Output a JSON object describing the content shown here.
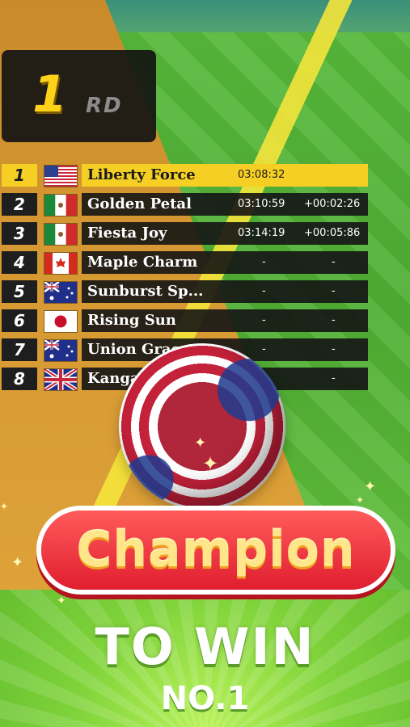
{
  "position": {
    "number": "1",
    "suffix": "RD"
  },
  "leaderboard": [
    {
      "pos": "1",
      "flag": "usa-flag",
      "name": "Liberty Force",
      "time": "03:08:32",
      "gap": ""
    },
    {
      "pos": "2",
      "flag": "mexico-flag",
      "name": "Golden Petal",
      "time": "03:10:59",
      "gap": "+00:02:26"
    },
    {
      "pos": "3",
      "flag": "mexico-flag",
      "name": "Fiesta Joy",
      "time": "03:14:19",
      "gap": "+00:05:86"
    },
    {
      "pos": "4",
      "flag": "canada-flag",
      "name": "Maple Charm",
      "time": "-",
      "gap": "-"
    },
    {
      "pos": "5",
      "flag": "australia-flag",
      "name": "Sunburst Sp...",
      "time": "-",
      "gap": "-"
    },
    {
      "pos": "6",
      "flag": "japan-flag",
      "name": "Rising Sun",
      "time": "-",
      "gap": "-"
    },
    {
      "pos": "7",
      "flag": "australia-flag",
      "name": "Union Grace",
      "time": "-",
      "gap": "-"
    },
    {
      "pos": "8",
      "flag": "uk-flag",
      "name": "Kangaroo Le...",
      "time": "-",
      "gap": "-"
    }
  ],
  "banner": {
    "title": "Champion"
  },
  "footer": {
    "line1": "TO WIN",
    "line2": "NO.1"
  },
  "colors": {
    "accent": "#f6cf24",
    "banner": "#e01e2f",
    "track": "#d79a33",
    "grass": "#56b83a"
  }
}
